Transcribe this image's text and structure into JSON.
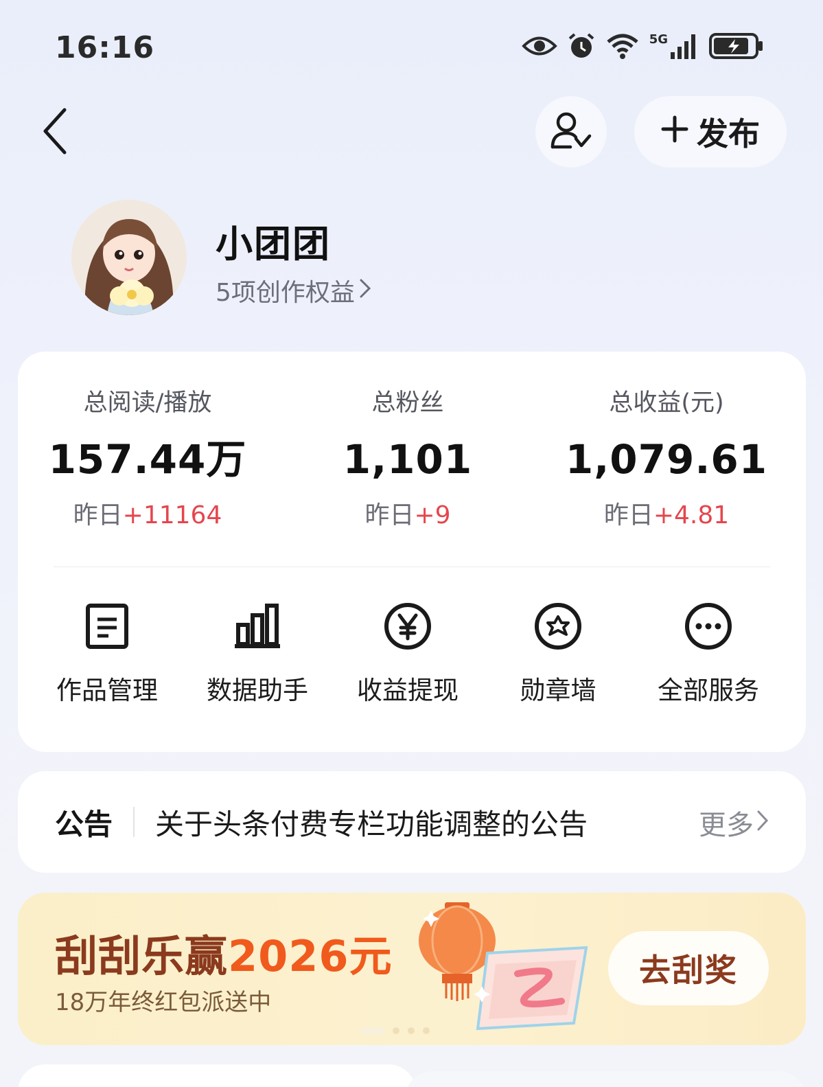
{
  "status_bar": {
    "time": "16:16",
    "network": "5G",
    "icons": [
      "eye-icon",
      "alarm-icon",
      "wifi-icon",
      "signal-icon",
      "battery-charging-icon"
    ]
  },
  "nav": {
    "back_icon": "chevron-left-icon",
    "profile_switch_icon": "user-check-icon",
    "publish_label": "发布"
  },
  "profile": {
    "name": "小团团",
    "rights_label": "5项创作权益"
  },
  "stats": [
    {
      "label": "总阅读/播放",
      "value": "157.44万",
      "delta_prefix": "昨日",
      "delta": "+11164"
    },
    {
      "label": "总粉丝",
      "value": "1,101",
      "delta_prefix": "昨日",
      "delta": "+9"
    },
    {
      "label": "总收益(元)",
      "value": "1,079.61",
      "delta_prefix": "昨日",
      "delta": "+4.81"
    }
  ],
  "services": [
    {
      "label": "作品管理",
      "icon": "document-icon"
    },
    {
      "label": "数据助手",
      "icon": "bar-chart-icon"
    },
    {
      "label": "收益提现",
      "icon": "yuan-icon"
    },
    {
      "label": "勋章墙",
      "icon": "badge-icon"
    },
    {
      "label": "全部服务",
      "icon": "more-icon"
    }
  ],
  "notice": {
    "title": "公告",
    "text": "关于头条付费专栏功能调整的公告",
    "more_label": "更多"
  },
  "banner": {
    "title_prefix": "刮刮乐赢",
    "title_amount": "2026元",
    "subtitle": "18万年终红包派送中",
    "button_label": "去刮奖",
    "page_count": 4,
    "active_page": 1
  },
  "colors": {
    "accent_red": "#e5464d",
    "banner_brown": "#8b3a1e",
    "banner_orange": "#f05a1c"
  }
}
